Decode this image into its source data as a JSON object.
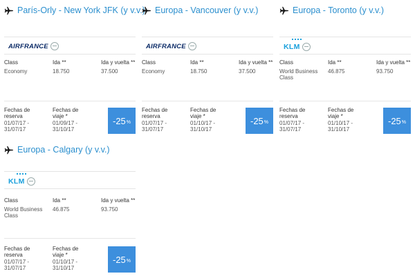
{
  "cards": [
    {
      "title": "París-Orly - New York JFK (y v.v.)",
      "airline": "AIRFRANCE",
      "logo": "airfrance",
      "class_label": "Class",
      "class_value": "Economy",
      "ida_label": "Ida **",
      "ida_value": "18.750",
      "iv_label": "Ida y vuelta **",
      "iv_value": "37.500",
      "reserva_label": "Fechas de reserva",
      "reserva_value": "01/07/17 - 31/07/17",
      "viaje_label": "Fechas de viaje *",
      "viaje_value": "01/09/17 - 31/10/17",
      "discount": "-25",
      "discount_unit": "%"
    },
    {
      "title": "Europa - Vancouver (y v.v.)",
      "airline": "AIRFRANCE",
      "logo": "airfrance",
      "class_label": "Class",
      "class_value": "Economy",
      "ida_label": "Ida **",
      "ida_value": "18.750",
      "iv_label": "Ida y vuelta **",
      "iv_value": "37.500",
      "reserva_label": "Fechas de reserva",
      "reserva_value": "01/07/17 - 31/07/17",
      "viaje_label": "Fechas de viaje *",
      "viaje_value": "01/10/17 - 31/10/17",
      "discount": "-25",
      "discount_unit": "%"
    },
    {
      "title": "Europa - Toronto (y v.v.)",
      "airline": "KLM",
      "logo": "klm",
      "class_label": "Class",
      "class_value": "World Business Class",
      "ida_label": "Ida **",
      "ida_value": "46.875",
      "iv_label": "Ida y vuelta **",
      "iv_value": "93.750",
      "reserva_label": "Fechas de reserva",
      "reserva_value": "01/07/17 - 31/07/17",
      "viaje_label": "Fechas de viaje *",
      "viaje_value": "01/10/17 - 31/10/17",
      "discount": "-25",
      "discount_unit": "%"
    },
    {
      "title": "Europa - Calgary (y v.v.)",
      "airline": "KLM",
      "logo": "klm",
      "class_label": "Class",
      "class_value": "World Business Class",
      "ida_label": "Ida **",
      "ida_value": "46.875",
      "iv_label": "Ida y vuelta **",
      "iv_value": "93.750",
      "reserva_label": "Fechas de reserva",
      "reserva_value": "01/07/17 - 31/07/17",
      "viaje_label": "Fechas de viaje *",
      "viaje_value": "01/10/17 - 31/10/17",
      "discount": "-25",
      "discount_unit": "%"
    }
  ],
  "icons": {
    "route": "plane-icon",
    "alliance": "skyteam-icon"
  },
  "colors": {
    "title": "#2b8fce",
    "discount_bg": "#3d8fdd",
    "af_blue": "#0a2a66",
    "af_red": "#d8232a",
    "klm_blue": "#1aa0dc"
  }
}
